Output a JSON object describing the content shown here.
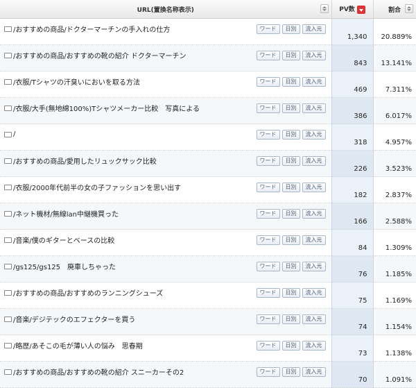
{
  "table": {
    "columns": {
      "url": "URL(置換名称表示)",
      "pv": "PV数",
      "ratio": "割合"
    },
    "buttons": {
      "word": "ワード",
      "daily": "日別",
      "referrer": "流入元"
    },
    "rows": [
      {
        "url": "/おすすめの商品/ドクターマーチンの手入れの仕方",
        "pv": "1,340",
        "ratio": "20.889%"
      },
      {
        "url": "/おすすめの商品/おすすめの靴の紹介 ドクターマーチン",
        "pv": "843",
        "ratio": "13.141%"
      },
      {
        "url": "/衣服/Tシャツの汗臭いにおいを取る方法",
        "pv": "469",
        "ratio": "7.311%"
      },
      {
        "url": "/衣服/大手(無地綿100%)Tシャツメーカー比較　写真による",
        "pv": "386",
        "ratio": "6.017%"
      },
      {
        "url": "/",
        "pv": "318",
        "ratio": "4.957%"
      },
      {
        "url": "/おすすめの商品/愛用したリュックサック比較",
        "pv": "226",
        "ratio": "3.523%"
      },
      {
        "url": "/衣服/2000年代前半の女の子ファッションを思い出す",
        "pv": "182",
        "ratio": "2.837%"
      },
      {
        "url": "/ネット機材/無線lan中継機買った",
        "pv": "166",
        "ratio": "2.588%"
      },
      {
        "url": "/音楽/僕のギターとベースの比較",
        "pv": "84",
        "ratio": "1.309%"
      },
      {
        "url": "/gs125/gs125　廃車しちゃった",
        "pv": "76",
        "ratio": "1.185%"
      },
      {
        "url": "/おすすめの商品/おすすめのランニングシューズ",
        "pv": "75",
        "ratio": "1.169%"
      },
      {
        "url": "/音楽/デジテックのエフェクターを買う",
        "pv": "74",
        "ratio": "1.154%"
      },
      {
        "url": "/略歴/あそこの毛が薄い人の悩み　思春期",
        "pv": "73",
        "ratio": "1.138%"
      },
      {
        "url": "/おすすめの商品/おすすめの靴の紹介 スニーカーその2",
        "pv": "70",
        "ratio": "1.091%"
      }
    ]
  }
}
